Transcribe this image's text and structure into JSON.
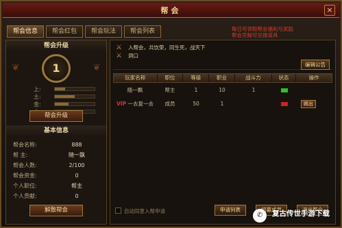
{
  "window": {
    "title": "帮会",
    "close": "×"
  },
  "tabs": [
    {
      "label": "帮会信息",
      "active": true
    },
    {
      "label": "帮会红包",
      "active": false
    },
    {
      "label": "帮会玩法",
      "active": false
    },
    {
      "label": "帮会列表",
      "active": false
    }
  ],
  "banner": {
    "line1": "每日可领取帮会福利与奖励",
    "line2": "帮会贡献可兑换道具"
  },
  "upgrade": {
    "heading": "帮会升级",
    "level": "1",
    "stats": [
      {
        "label": "上:",
        "value": 0.25
      },
      {
        "label": "土:",
        "value": 0.5
      },
      {
        "label": "金:",
        "value": 0.35
      },
      {
        "label": "木:",
        "value": 0.4
      }
    ],
    "upgrade_button": "帮会升级"
  },
  "basic": {
    "heading": "基本信息",
    "rows": [
      {
        "k": "帮会名称:",
        "v": "888"
      },
      {
        "k": "帮    主:",
        "v": "随一飘"
      },
      {
        "k": "帮会人数:",
        "v": "2/100"
      },
      {
        "k": "帮会资金:",
        "v": "0"
      },
      {
        "k": "个人职位:",
        "v": "帮主"
      },
      {
        "k": "个人贡献:",
        "v": "0"
      }
    ],
    "leave_button": "解散帮会"
  },
  "notice": {
    "line1": "入帮会，共饮荣，同生死，战天下",
    "line2": "洞口",
    "edit_button": "编辑公告"
  },
  "table": {
    "headers": [
      "玩家名称",
      "职位",
      "等级",
      "职业",
      "战斗力",
      "状态",
      "操作"
    ],
    "rows": [
      {
        "vip": "",
        "name": "随一飘",
        "pos": "帮主",
        "lvl": "1",
        "job": "10",
        "power": "1",
        "status_color": "#30c030",
        "action": ""
      },
      {
        "vip": "VIP",
        "name": "一去复一去",
        "pos": "成员",
        "lvl": "50",
        "job": "1",
        "power": "",
        "status_color": "#d02020",
        "action": "踢出"
      }
    ]
  },
  "bottom": {
    "auto_label": "自动同意入帮申请",
    "btn1": "申请列表",
    "btn2": "招募成员",
    "btn3": "退出帮会"
  },
  "watermark": {
    "text": "复古传世手游下载",
    "icon": "wechat-icon"
  }
}
